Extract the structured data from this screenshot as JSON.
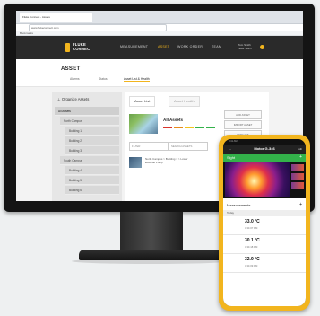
{
  "browser": {
    "tab_title": "Fluke Connect - Assets",
    "address": "www.flukeconnect.com",
    "bookmarks": "Bookmarks"
  },
  "app": {
    "logo_line1": "FLUKE",
    "logo_line2": "CONNECT",
    "nav": [
      "MEASUREMENT",
      "ASSET",
      "WORK ORDER",
      "TEAM"
    ],
    "active_nav": "ASSET",
    "user_line1": "Tom Smith",
    "user_line2": "Fluke Team"
  },
  "page": {
    "title": "ASSET",
    "subnav": [
      "Alarms",
      "Status",
      "Asset List & Health"
    ],
    "active_subnav": "Asset List & Health"
  },
  "sidebar": {
    "title": "Organize Assets",
    "items": [
      {
        "label": "All Assets",
        "level": 0
      },
      {
        "label": "North Campus",
        "level": 1
      },
      {
        "label": "Building 1",
        "level": 2
      },
      {
        "label": "Building 2",
        "level": 2
      },
      {
        "label": "Building 3",
        "level": 2
      },
      {
        "label": "South Campus",
        "level": 1
      },
      {
        "label": "Building 4",
        "level": 2
      },
      {
        "label": "Building 5",
        "level": 2
      },
      {
        "label": "Building 6",
        "level": 2
      }
    ]
  },
  "main": {
    "tabs": [
      "Asset List",
      "Asset Health"
    ],
    "active_tab": "Asset List",
    "header": "All Assets",
    "buttons": [
      "ADD ASSET",
      "IMPORT ASSET",
      "EDIT LIST"
    ],
    "filter_placeholder": "FILTER",
    "search_placeholder": "SEARCH ASSETS",
    "rows": [
      {
        "line1": "North Campus > Building 1 > Lower",
        "line2": "External Pump"
      }
    ],
    "status_colors": [
      "#d9342b",
      "#e88a1a",
      "#f2c31e",
      "#33b24a",
      "#33b24a"
    ]
  },
  "phone": {
    "status": "9:41 AM",
    "title": "Motor G-346",
    "edit": "Edit",
    "section": "Sight",
    "measurements_title": "Measurements",
    "today": "Today",
    "measurements": [
      {
        "value": "33.0 °C",
        "time": "3:34:07 PM"
      },
      {
        "value": "30.1 °C",
        "time": "3:34:18 PM"
      },
      {
        "value": "32.9 °C",
        "time": "3:34:09 PM"
      }
    ]
  },
  "colors": {
    "accent": "#f2b51e",
    "green": "#33b24a",
    "dark": "#2a2a2a"
  }
}
